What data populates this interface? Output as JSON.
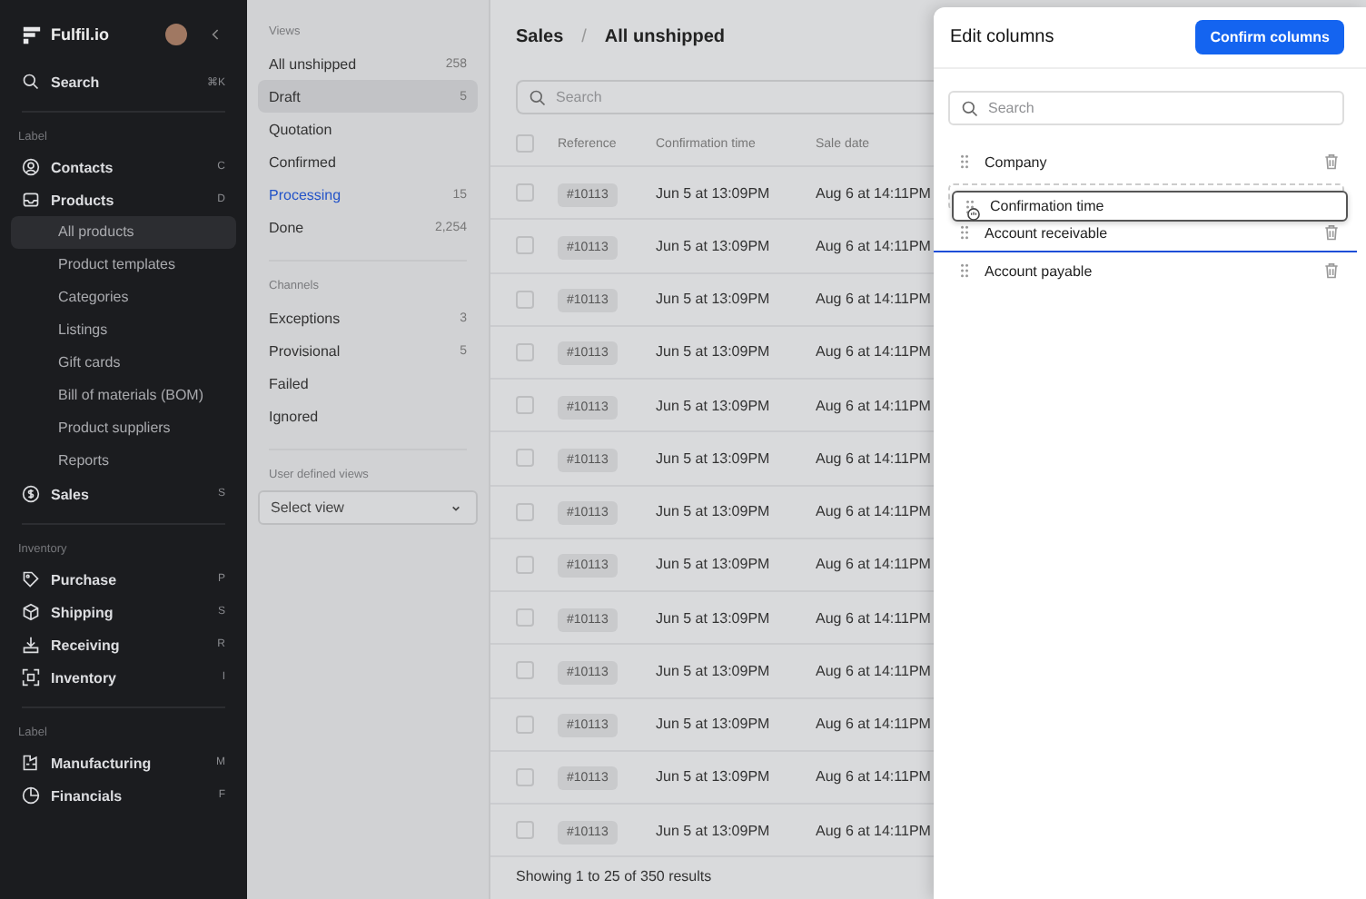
{
  "sidebar": {
    "brand": "Fulfil.io",
    "search": {
      "label": "Search",
      "shortcut": "⌘K"
    },
    "sections": [
      {
        "label": "Label",
        "items": [
          {
            "label": "Contacts",
            "shortcut": "C",
            "selected": false
          },
          {
            "label": "Products",
            "shortcut": "D",
            "selected": false,
            "children": [
              {
                "label": "All products",
                "selected": true
              },
              {
                "label": "Product templates",
                "selected": false
              },
              {
                "label": "Categories",
                "selected": false
              },
              {
                "label": "Listings",
                "selected": false
              },
              {
                "label": "Gift cards",
                "selected": false
              },
              {
                "label": "Bill of materials (BOM)",
                "selected": false
              },
              {
                "label": "Product suppliers",
                "selected": false
              },
              {
                "label": "Reports",
                "selected": false
              }
            ]
          },
          {
            "label": "Sales",
            "shortcut": "S",
            "selected": false
          }
        ]
      },
      {
        "label": "Inventory",
        "items": [
          {
            "label": "Purchase",
            "shortcut": "P",
            "selected": false
          },
          {
            "label": "Shipping",
            "shortcut": "S",
            "selected": false
          },
          {
            "label": "Receiving",
            "shortcut": "R",
            "selected": false
          },
          {
            "label": "Inventory",
            "shortcut": "I",
            "selected": false
          }
        ]
      },
      {
        "label": "Label",
        "items": [
          {
            "label": "Manufacturing",
            "shortcut": "M",
            "selected": false
          },
          {
            "label": "Financials",
            "shortcut": "F",
            "selected": false
          }
        ]
      }
    ]
  },
  "views_panel": {
    "groups": [
      {
        "label": "Views",
        "items": [
          {
            "label": "All unshipped",
            "count": "258",
            "selected": false,
            "active": false
          },
          {
            "label": "Draft",
            "count": "5",
            "selected": true,
            "active": false
          },
          {
            "label": "Quotation",
            "selected": false,
            "active": false
          },
          {
            "label": "Confirmed",
            "selected": false,
            "active": false
          },
          {
            "label": "Processing",
            "count": "15",
            "selected": false,
            "active": true
          },
          {
            "label": "Done",
            "count": "2,254",
            "selected": false,
            "active": false
          }
        ]
      },
      {
        "label": "Channels",
        "items": [
          {
            "label": "Exceptions",
            "count": "3",
            "selected": false,
            "active": false
          },
          {
            "label": "Provisional",
            "count": "5",
            "selected": false,
            "active": false
          },
          {
            "label": "Failed",
            "selected": false,
            "active": false
          },
          {
            "label": "Ignored",
            "selected": false,
            "active": false
          }
        ]
      }
    ],
    "user_views": {
      "label": "User defined views",
      "select": "Select view"
    }
  },
  "main": {
    "breadcrumb": [
      "Sales",
      "/",
      "All unshipped"
    ],
    "search": {
      "placeholder": "Search"
    },
    "table": {
      "header_checked": false,
      "columns": [
        "Reference",
        "Confirmation time",
        "Sale date"
      ],
      "rows": [
        {
          "checked": false,
          "reference": "#10113",
          "confirmation_time": "Jun 5 at 13:09PM",
          "sale_date": "Aug 6 at 14:11PM"
        },
        {
          "checked": false,
          "reference": "#10113",
          "confirmation_time": "Jun 5 at 13:09PM",
          "sale_date": "Aug 6 at 14:11PM"
        },
        {
          "checked": false,
          "reference": "#10113",
          "confirmation_time": "Jun 5 at 13:09PM",
          "sale_date": "Aug 6 at 14:11PM"
        },
        {
          "checked": false,
          "reference": "#10113",
          "confirmation_time": "Jun 5 at 13:09PM",
          "sale_date": "Aug 6 at 14:11PM"
        },
        {
          "checked": false,
          "reference": "#10113",
          "confirmation_time": "Jun 5 at 13:09PM",
          "sale_date": "Aug 6 at 14:11PM"
        },
        {
          "checked": false,
          "reference": "#10113",
          "confirmation_time": "Jun 5 at 13:09PM",
          "sale_date": "Aug 6 at 14:11PM"
        },
        {
          "checked": false,
          "reference": "#10113",
          "confirmation_time": "Jun 5 at 13:09PM",
          "sale_date": "Aug 6 at 14:11PM"
        },
        {
          "checked": false,
          "reference": "#10113",
          "confirmation_time": "Jun 5 at 13:09PM",
          "sale_date": "Aug 6 at 14:11PM"
        },
        {
          "checked": false,
          "reference": "#10113",
          "confirmation_time": "Jun 5 at 13:09PM",
          "sale_date": "Aug 6 at 14:11PM"
        },
        {
          "checked": false,
          "reference": "#10113",
          "confirmation_time": "Jun 5 at 13:09PM",
          "sale_date": "Aug 6 at 14:11PM"
        },
        {
          "checked": false,
          "reference": "#10113",
          "confirmation_time": "Jun 5 at 13:09PM",
          "sale_date": "Aug 6 at 14:11PM"
        },
        {
          "checked": false,
          "reference": "#10113",
          "confirmation_time": "Jun 5 at 13:09PM",
          "sale_date": "Aug 6 at 14:11PM"
        },
        {
          "checked": false,
          "reference": "#10113",
          "confirmation_time": "Jun 5 at 13:09PM",
          "sale_date": "Aug 6 at 14:11PM"
        }
      ],
      "footer": "Showing 1 to 25 of 350 results"
    }
  },
  "edit_columns": {
    "title": "Edit columns",
    "confirm_button": "Confirm columns",
    "search": {
      "placeholder": "Search"
    },
    "items": [
      {
        "kind": "column",
        "label": "Company"
      },
      {
        "kind": "drop-slot"
      },
      {
        "kind": "column",
        "label": "Account receivable"
      },
      {
        "kind": "drop-indicator"
      },
      {
        "kind": "column",
        "label": "Account payable"
      }
    ],
    "dragging": {
      "label": "Confirmation time"
    }
  }
}
